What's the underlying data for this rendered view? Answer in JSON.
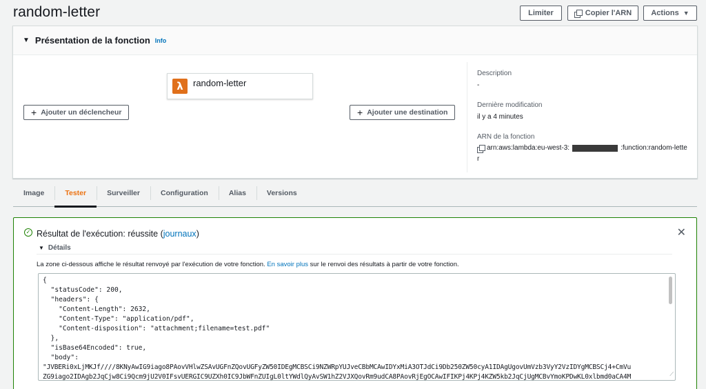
{
  "header": {
    "title": "random-letter",
    "throttle_label": "Limiter",
    "copy_arn_label": "Copier l'ARN",
    "actions_label": "Actions"
  },
  "overview": {
    "title": "Présentation de la fonction",
    "info_label": "Info",
    "function_name": "random-letter",
    "add_trigger_label": "Ajouter un déclencheur",
    "add_destination_label": "Ajouter une destination",
    "description_label": "Description",
    "description_value": "-",
    "last_modified_label": "Dernière modification",
    "last_modified_value": "il y a 4 minutes",
    "arn_label": "ARN de la fonction",
    "arn_prefix": "arn:aws:lambda:eu-west-3:",
    "arn_suffix": ":function:random-lette",
    "arn_wrap": "r"
  },
  "tabs": [
    {
      "label": "Image"
    },
    {
      "label": "Tester"
    },
    {
      "label": "Surveiller"
    },
    {
      "label": "Configuration"
    },
    {
      "label": "Alias"
    },
    {
      "label": "Versions"
    }
  ],
  "active_tab": "Tester",
  "result": {
    "title_prefix": "Résultat de l'exécution: réussite (",
    "logs_link": "journaux",
    "title_suffix": ")",
    "details_label": "Détails",
    "desc_text": "La zone ci-dessous affiche le résultat renvoyé par l'exécution de votre fonction. ",
    "learn_more_label": "En savoir plus",
    "desc_text_after": " sur le renvoi des résultats à partir de votre fonction.",
    "code_lines": [
      "{",
      "  \"statusCode\": 200,",
      "  \"headers\": {",
      "    \"Content-Length\": 2632,",
      "    \"Content-Type\": \"application/pdf\",",
      "    \"Content-disposition\": \"attachment;filename=test.pdf\"",
      "  },",
      "  \"isBase64Encoded\": true,",
      "  \"body\":",
      "\"JVBERi0xLjMKJf////8KNyAwIG9iago8PAovVHlwZSAvUGFnZQovUGFyZW50IDEgMCBSCi9NZWRpYUJveCBbMCAwIDYxMiA3OTJdCi9Db250ZW50cyA1IDAgUgovUmVzb3VyY2VzIDYgMCBSCj4+CmVu",
      "ZG9iago2IDAgb2JqCjw8Ci9Qcm9jU2V0IFsvUERGIC9UZXh0IC9JbWFnZUIgL0ltYWdlQyAvSW1hZ2VJXQovRm9udCA8PAovRjEgOCAwIFIKPj4KPj4KZW5kb2JqCjUgMCBvYmoKPDwKL0xlbmd0aCA4M"
    ]
  }
}
